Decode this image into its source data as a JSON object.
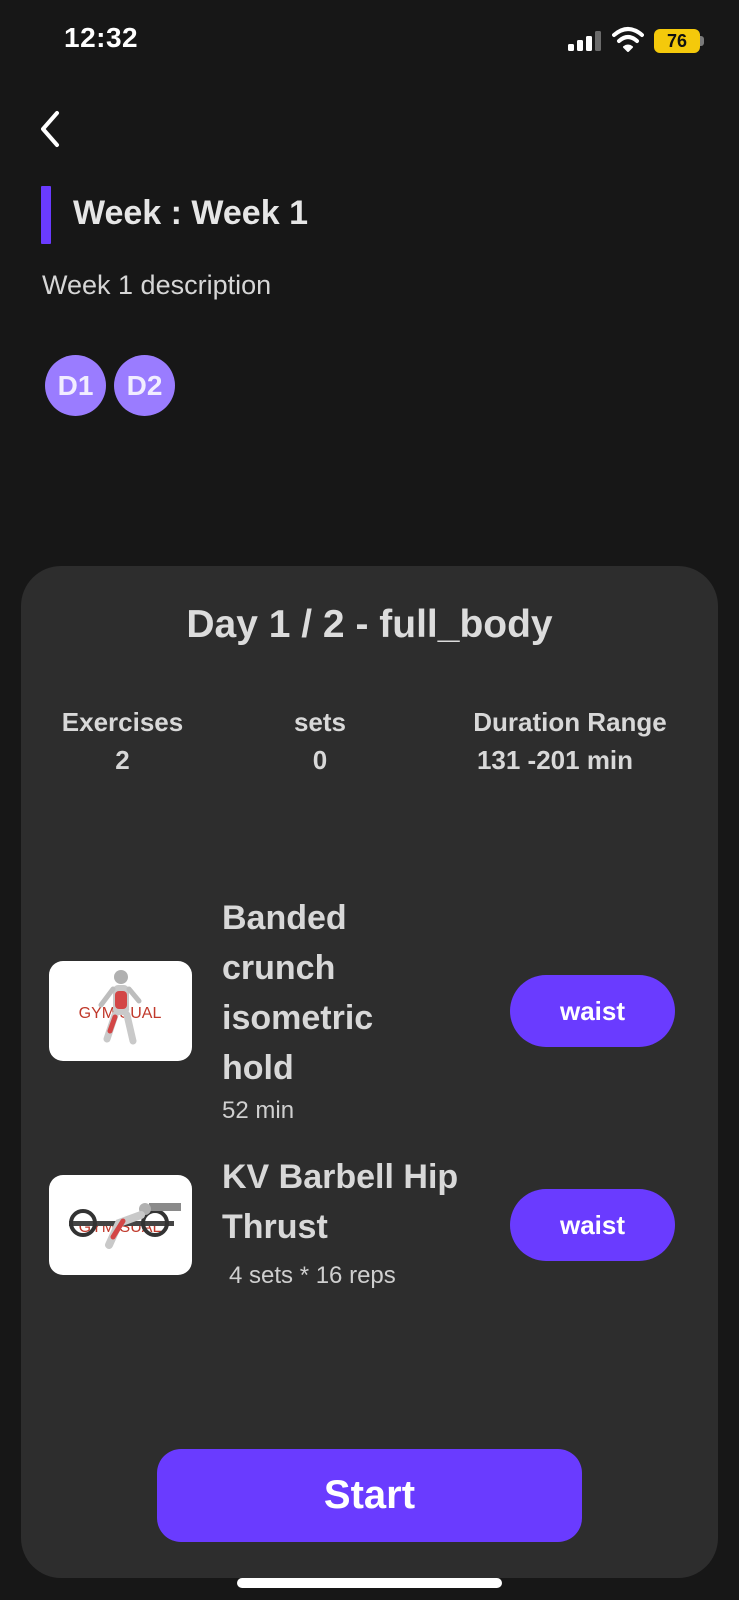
{
  "status_bar": {
    "time": "12:32",
    "battery": "76",
    "icons": [
      "signal-icon",
      "wifi-icon",
      "battery-icon"
    ]
  },
  "header": {
    "back_icon": "chevron-left-icon",
    "title": "Week : Week 1",
    "description": "Week 1 description"
  },
  "days": [
    {
      "label": "D1"
    },
    {
      "label": "D2"
    }
  ],
  "card": {
    "title": "Day 1 / 2 - full_body",
    "stats": [
      {
        "label": "Exercises",
        "value": "2"
      },
      {
        "label": "sets",
        "value": "0"
      },
      {
        "label": "Duration Range",
        "value": "131 -201 min"
      }
    ],
    "exercises": [
      {
        "name_lines": [
          "Banded",
          "crunch",
          "isometric",
          "hold"
        ],
        "detail": "52 min",
        "tag": "waist",
        "thumb_text": "GYM   SUAL"
      },
      {
        "name_lines": [
          "KV Barbell Hip",
          "Thrust"
        ],
        "detail": "4 sets * 16 reps",
        "tag": "waist",
        "thumb_text": "GYM   SUAL"
      }
    ],
    "start_label": "Start"
  },
  "colors": {
    "background": "#171717",
    "card": "#2d2d2d",
    "accent": "#6a3bff",
    "chip": "#9a7cff",
    "battery": "#f4c90b"
  }
}
